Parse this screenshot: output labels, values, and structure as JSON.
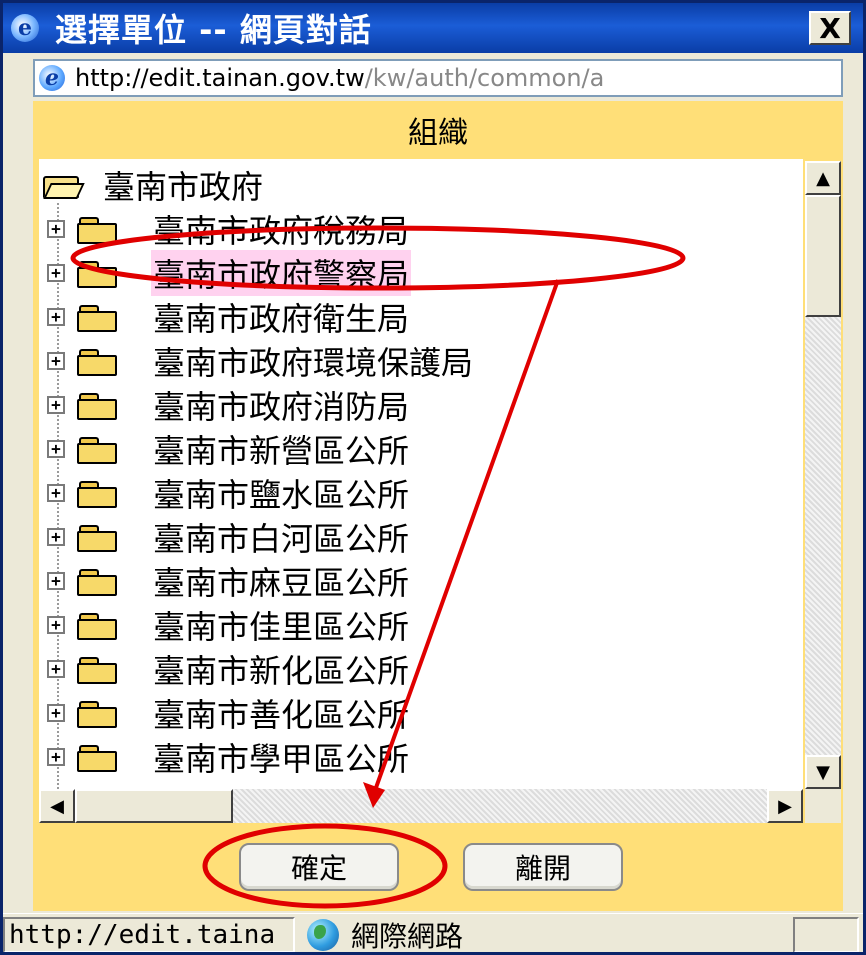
{
  "window": {
    "title": "選擇單位 -- 網頁對話",
    "close_glyph": "X",
    "ie_glyph": "e",
    "url_host": "http://edit.tainan.gov.tw",
    "url_path": "/kw/auth/common/a"
  },
  "panel": {
    "header": "組織",
    "root_label": "臺南市政府",
    "selected_index": 1,
    "items": [
      {
        "label": "臺南市政府稅務局"
      },
      {
        "label": "臺南市政府警察局"
      },
      {
        "label": "臺南市政府衛生局"
      },
      {
        "label": "臺南市政府環境保護局"
      },
      {
        "label": "臺南市政府消防局"
      },
      {
        "label": "臺南市新營區公所"
      },
      {
        "label": "臺南市鹽水區公所"
      },
      {
        "label": "臺南市白河區公所"
      },
      {
        "label": "臺南市麻豆區公所"
      },
      {
        "label": "臺南市佳里區公所"
      },
      {
        "label": "臺南市新化區公所"
      },
      {
        "label": "臺南市善化區公所"
      },
      {
        "label": "臺南市學甲區公所"
      }
    ],
    "expander_glyph": "+"
  },
  "scroll": {
    "up": "▲",
    "down": "▼",
    "left": "◀",
    "right": "▶"
  },
  "buttons": {
    "confirm": "確定",
    "leave": "離開"
  },
  "status": {
    "url": "http://edit.taina",
    "zone": "網際網路"
  },
  "colors": {
    "titlebar": "#0a3da6",
    "panel": "#ffdf78",
    "selection": "#ffd2ef",
    "annotation": "#e00000"
  }
}
